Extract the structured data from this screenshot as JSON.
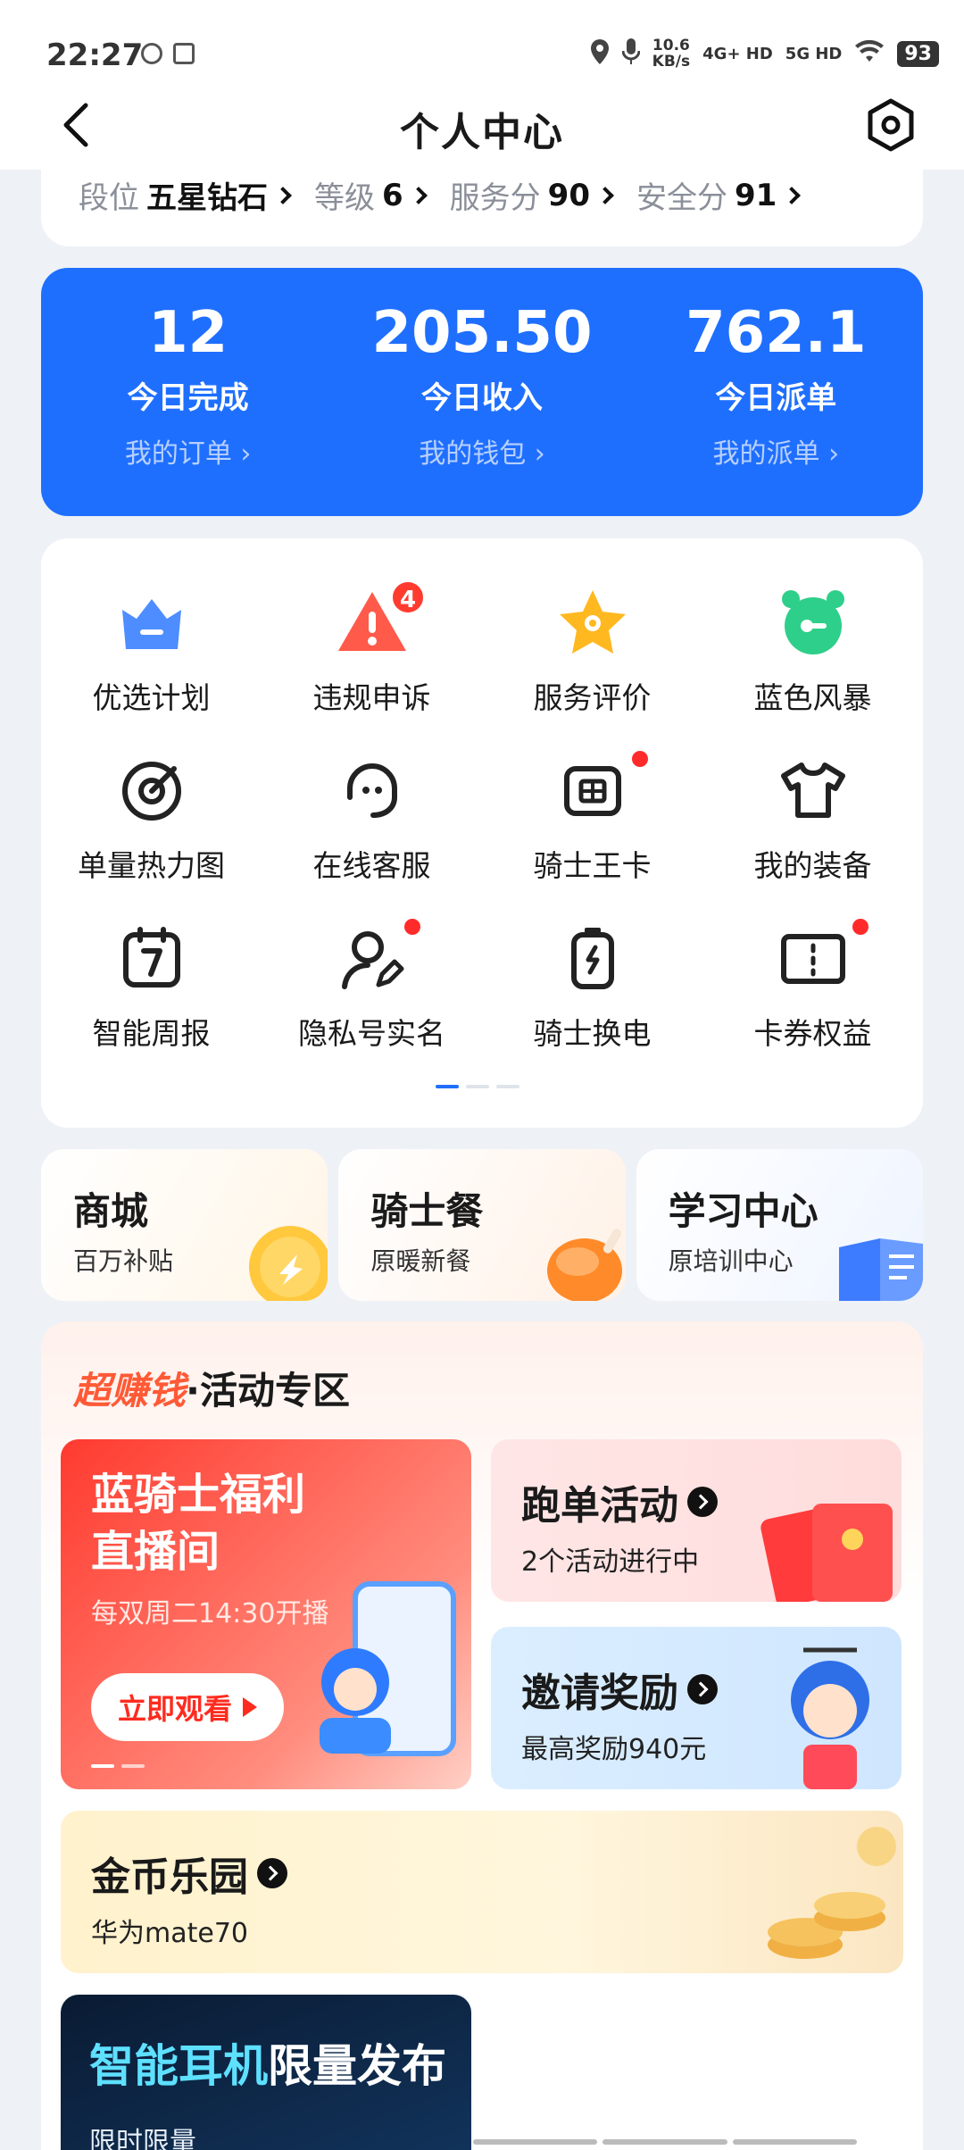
{
  "status_bar": {
    "time": "22:27",
    "speed_value": "10.6",
    "speed_unit": "KB/s",
    "network_1": "4G+ HD",
    "network_2": "5G HD",
    "battery": "93"
  },
  "nav": {
    "title": "个人中心"
  },
  "rank": {
    "items": [
      {
        "label": "段位",
        "value": "五星钻石"
      },
      {
        "label": "等级",
        "value": "6"
      },
      {
        "label": "服务分",
        "value": "90"
      },
      {
        "label": "安全分",
        "value": "91"
      }
    ]
  },
  "stats": [
    {
      "value": "12",
      "label": "今日完成",
      "link": "我的订单"
    },
    {
      "value": "205.50",
      "label": "今日收入",
      "link": "我的钱包"
    },
    {
      "value": "762.1",
      "label": "今日派单",
      "link": "我的派单"
    }
  ],
  "grid": [
    {
      "label": "优选计划",
      "icon": "crown-icon"
    },
    {
      "label": "违规申诉",
      "icon": "warning-icon",
      "badge": "4"
    },
    {
      "label": "服务评价",
      "icon": "star-icon"
    },
    {
      "label": "蓝色风暴",
      "icon": "alarm-clock-icon"
    },
    {
      "label": "单量热力图",
      "icon": "target-icon"
    },
    {
      "label": "在线客服",
      "icon": "headset-icon"
    },
    {
      "label": "骑士王卡",
      "icon": "sim-card-icon"
    },
    {
      "label": "我的装备",
      "icon": "tshirt-icon"
    },
    {
      "label": "智能周报",
      "icon": "calendar-icon"
    },
    {
      "label": "隐私号实名",
      "icon": "user-edit-icon"
    },
    {
      "label": "骑士换电",
      "icon": "battery-icon"
    },
    {
      "label": "卡券权益",
      "icon": "coupon-icon"
    }
  ],
  "shortcuts": [
    {
      "title": "商城",
      "subtitle": "百万补贴"
    },
    {
      "title": "骑士餐",
      "subtitle": "原暖新餐"
    },
    {
      "title": "学习中心",
      "subtitle": "原培训中心"
    }
  ],
  "activity": {
    "heading_hot": "超赚钱",
    "heading": "·活动专区",
    "live": {
      "title": "蓝骑士福利直播间",
      "subtitle": "每双周二14:30开播",
      "button": "立即观看"
    },
    "run": {
      "title": "跑单活动",
      "subtitle": "2个活动进行中"
    },
    "invite": {
      "title": "邀请奖励",
      "subtitle": "最高奖励940元"
    },
    "coin": {
      "title": "金币乐园",
      "subtitle": "华为mate70"
    },
    "ad": {
      "title_colored": "智能耳机",
      "title_rest": "限量发布",
      "subtitle": "限时限量"
    }
  },
  "colors": {
    "primary": "#1f6fff",
    "badge": "#ff3b30",
    "hot": "#ff5a36"
  }
}
